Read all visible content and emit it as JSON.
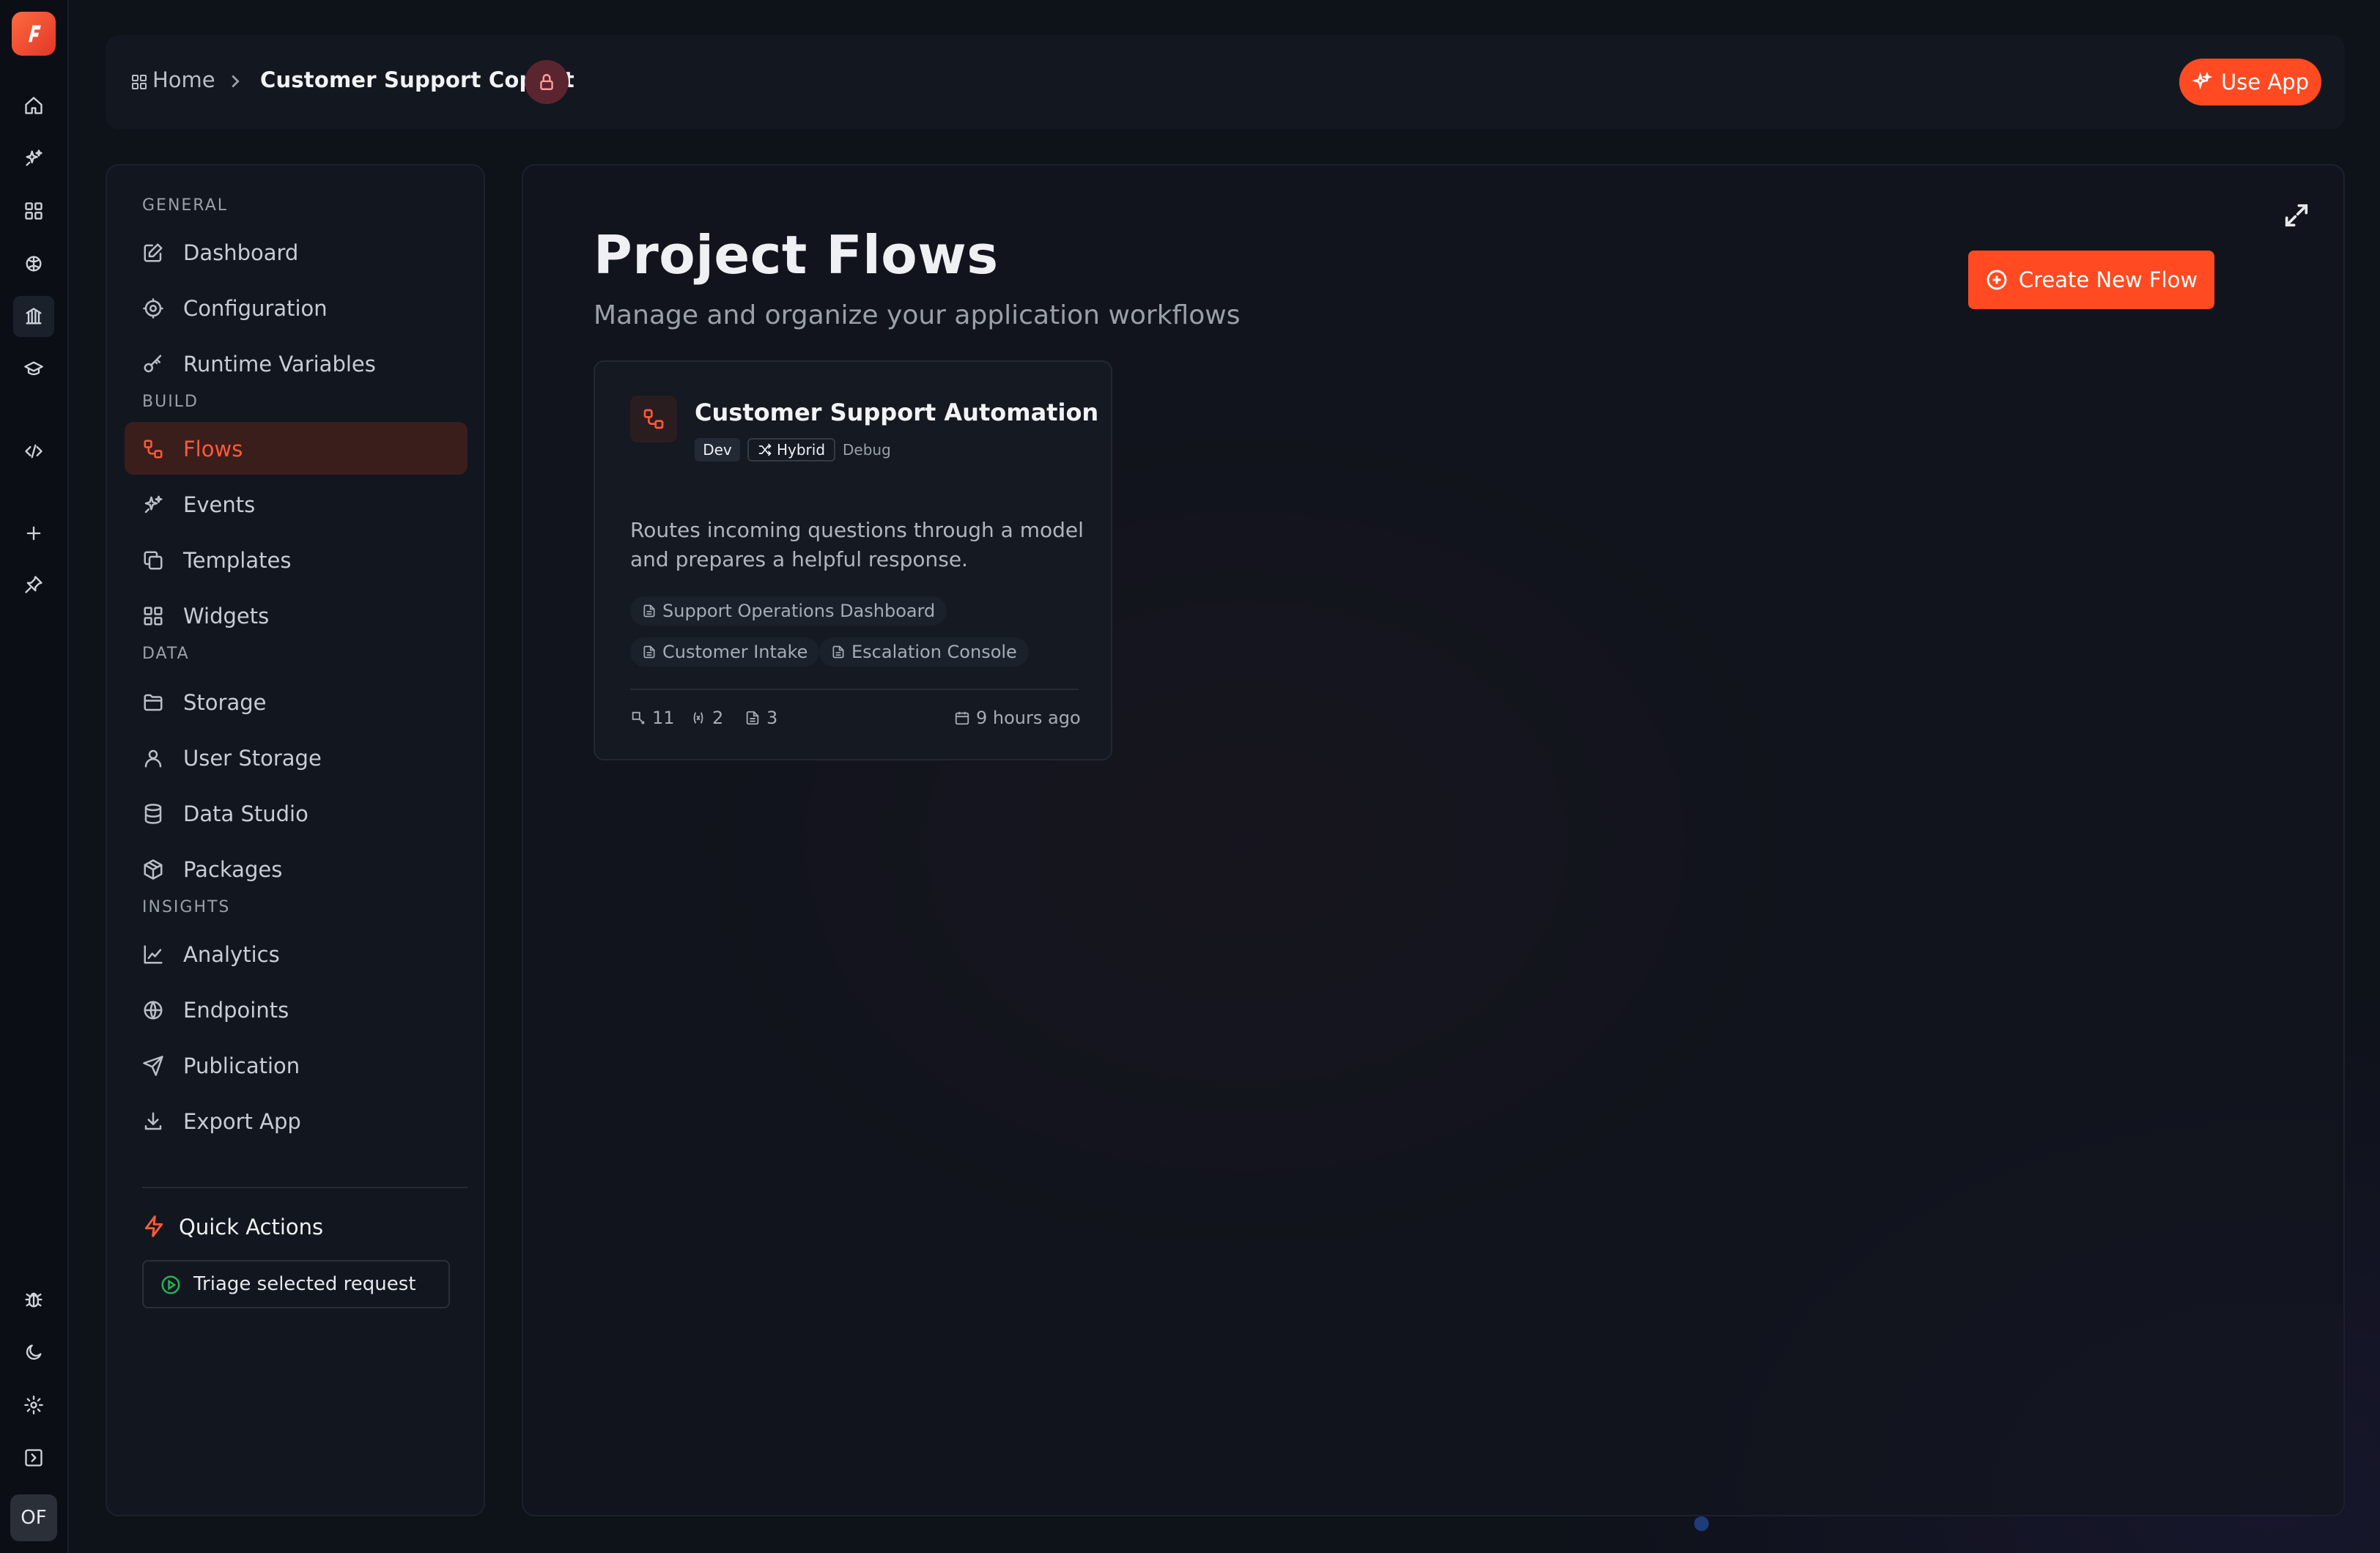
{
  "breadcrumb": {
    "home": "Home",
    "current": "Customer Support Copilot"
  },
  "topbar": {
    "use_app": "Use App"
  },
  "rail": {
    "avatar": "OF",
    "icons": [
      "logo-icon",
      "home-icon",
      "sparkles-icon",
      "grid-icon",
      "brain-icon",
      "library-icon",
      "graduation-cap-icon",
      "code-icon",
      "plus-icon",
      "pin-icon",
      "bug-icon",
      "moon-icon",
      "gear-icon",
      "panel-toggle-icon"
    ]
  },
  "nav": {
    "sections": {
      "general": "GENERAL",
      "build": "BUILD",
      "data": "DATA",
      "insights": "INSIGHTS"
    },
    "items": {
      "dashboard": "Dashboard",
      "configuration": "Configuration",
      "runtime_variables": "Runtime Variables",
      "flows": "Flows",
      "events": "Events",
      "templates": "Templates",
      "widgets": "Widgets",
      "storage": "Storage",
      "user_storage": "User Storage",
      "data_studio": "Data Studio",
      "packages": "Packages",
      "analytics": "Analytics",
      "endpoints": "Endpoints",
      "publication": "Publication",
      "export_app": "Export App"
    },
    "active": "flows",
    "quick_actions": {
      "title": "Quick Actions",
      "action": "Triage selected request"
    }
  },
  "main": {
    "title": "Project Flows",
    "subtitle": "Manage and organize your application workflows",
    "create_button": "Create New Flow"
  },
  "flow_card": {
    "name": "Customer Support Automation",
    "badges": {
      "env": "Dev",
      "mode": "Hybrid",
      "debug": "Debug"
    },
    "description": "Routes incoming questions through a model and prepares a helpful response.",
    "tags": [
      "Support Operations Dashboard",
      "Customer Intake",
      "Escalation Console"
    ],
    "stats": {
      "nodes": "11",
      "variables": "2",
      "pages": "3",
      "updated": "9 hours ago"
    }
  },
  "colors": {
    "accent": "#ff4a22",
    "background": "#0e1219",
    "panel": "#12161e",
    "success": "#22b35e"
  }
}
